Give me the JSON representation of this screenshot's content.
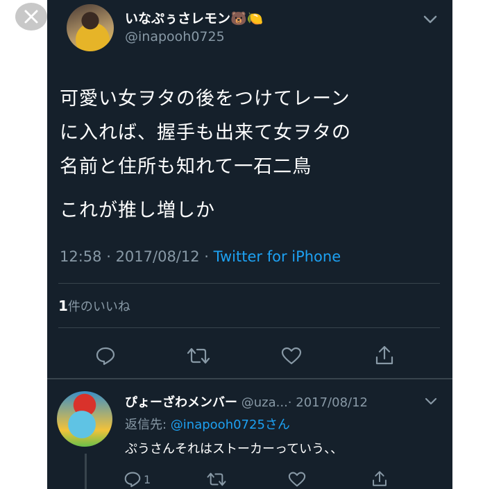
{
  "tweet": {
    "author_name": "いなぷぅさレモン🐻🍋",
    "author_handle": "@inapooh0725",
    "text_lines": [
      "可愛い女ヲタの後をつけてレーン",
      "に入れば、握手も出来て女ヲタの",
      "名前と住所も知れて一石二鳥"
    ],
    "text_line4": "これが推し増しか",
    "time": "12:58",
    "date": "2017/08/12",
    "separator": " · ",
    "source": "Twitter for iPhone",
    "likes_count": "1",
    "likes_label": "件のいいね"
  },
  "reply": {
    "name": "ぴょーざわメンバー",
    "handle": "@uza...",
    "date": "2017/08/12",
    "separator": "· ",
    "reply_to_label": "返信先: ",
    "reply_to_mention": "@inapooh0725さん",
    "text": "ぷうさんそれはストーカーっていう、、",
    "reply_count": "1"
  },
  "icons": {
    "close": "close-icon",
    "chevron": "chevron-down-icon",
    "reply": "reply-icon",
    "retweet": "retweet-icon",
    "like": "heart-icon",
    "share": "share-icon"
  },
  "colors": {
    "background": "#15202b",
    "secondary_text": "#8899a6",
    "link": "#1da1f2",
    "divider": "#38444d"
  }
}
